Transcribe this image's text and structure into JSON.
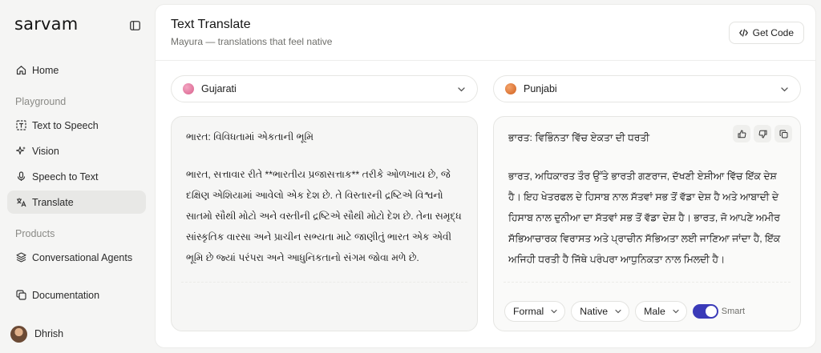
{
  "sidebar": {
    "brand": "sarvam",
    "items": {
      "home": "Home",
      "tts": "Text to Speech",
      "vision": "Vision",
      "stt": "Speech to Text",
      "translate": "Translate",
      "agents": "Conversational Agents",
      "docs": "Documentation"
    },
    "sections": {
      "playground": "Playground",
      "products": "Products"
    },
    "user": "Dhrish"
  },
  "header": {
    "title": "Text Translate",
    "subtitle": "Mayura — translations that feel native",
    "get_code": "Get Code"
  },
  "source": {
    "language": "Gujarati",
    "language_color": "#e07aa0",
    "heading": "ભારત: વિવિધતામાં એકતાની ભૂમિ",
    "body": "ભારત, સત્તાવાર રીતે **ભારતીય પ્રજાસત્તાક** તરીકે ઓળખાય છે, જે દક્ષિણ એશિયામાં આવેલો એક દેશ છે. તે વિસ્તારની દ્રષ્ટિએ વિશ્વનો સાતમો સૌથી મોટો અને વસ્તીની દ્રષ્ટિએ સૌથી મોટો દેશ છે. તેના સમૃદ્ધ સાંસ્કૃતિક વારસા અને પ્રાચીન સભ્યતા માટે જાણીતું ભારત એક એવી ભૂમિ છે જ્યાં પરંપરા અને આધુનિકતાનો સંગમ જોવા મળે છે."
  },
  "target": {
    "language": "Punjabi",
    "language_color": "#e07a3a",
    "heading": "ਭਾਰਤ: ਵਿਭਿੰਨਤਾ ਵਿੱਚ ਏਕਤਾ ਦੀ ਧਰਤੀ",
    "body": "ਭਾਰਤ, ਅਧਿਕਾਰਤ ਤੌਰ ਉੱਤੇ ਭਾਰਤੀ ਗਣਰਾਜ, ਦੱਖਣੀ ਏਸ਼ੀਆ ਵਿੱਚ ਇੱਕ ਦੇਸ਼ ਹੈ। ਇਹ ਖੇਤਰਫਲ ਦੇ ਹਿਸਾਬ ਨਾਲ ਸੱਤਵਾਂ ਸਭ ਤੋਂ ਵੱਡਾ ਦੇਸ਼ ਹੈ ਅਤੇ ਆਬਾਦੀ ਦੇ ਹਿਸਾਬ ਨਾਲ ਦੁਨੀਆ ਦਾ ਸੱਤਵਾਂ ਸਭ ਤੋਂ ਵੱਡਾ ਦੇਸ਼ ਹੈ। ਭਾਰਤ, ਜੋ ਆਪਣੇ ਅਮੀਰ ਸੱਭਿਆਚਾਰਕ ਵਿਰਾਸਤ ਅਤੇ ਪ੍ਰਾਚੀਨ ਸੱਭਿਅਤਾ ਲਈ ਜਾਣਿਆ ਜਾਂਦਾ ਹੈ, ਇੱਕ ਅਜਿਹੀ ਧਰਤੀ ਹੈ ਜਿੱਥੇ ਪਰੰਪਰਾ ਆਧੁਨਿਕਤਾ ਨਾਲ ਮਿਲਦੀ ਹੈ।",
    "options": {
      "formality": "Formal",
      "style": "Native",
      "gender": "Male",
      "smart_label": "Smart"
    },
    "smart_on": true,
    "accent": "#3a3ab8"
  }
}
